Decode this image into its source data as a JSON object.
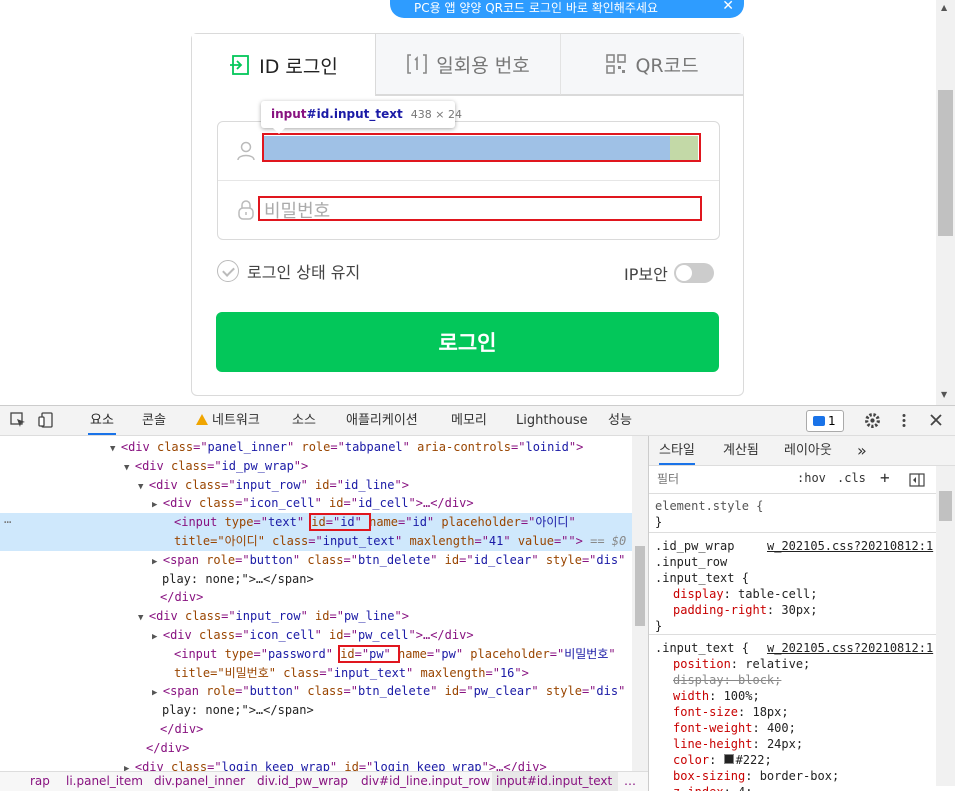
{
  "banner": {
    "text": "PC용 앱 양양 QR코드 로그인 바로 확인해주세요",
    "close": "✕"
  },
  "tabs": [
    {
      "label": "ID 로그인",
      "icon": "login-arrow-icon"
    },
    {
      "label": "일회용 번호",
      "icon": "number-one-icon"
    },
    {
      "label": "QR코드",
      "icon": "qr-code-icon"
    }
  ],
  "form": {
    "id_placeholder": "아이디",
    "pw_placeholder": "비밀번호",
    "keep_login": "로그인 상태 유지",
    "ip_security": "IP보안",
    "login_button": "로그인"
  },
  "tooltip": {
    "tag": "input",
    "selector": "#id.input_text",
    "size": "438 × 24"
  },
  "devtools": {
    "tabs": [
      "요소",
      "콘솔",
      "네트워크",
      "소스",
      "애플리케이션",
      "메모리",
      "Lighthouse",
      "성능"
    ],
    "badge_count": "1",
    "style_tabs": [
      "스타일",
      "계산됨",
      "레이아웃",
      "»"
    ],
    "filter_placeholder": "필터",
    "filter_hov": ":hov",
    "filter_cls": ".cls",
    "filter_plus": "+",
    "dom_lines": [
      {
        "pre": "<div ",
        "attrs": [
          [
            "class",
            "panel_inner"
          ],
          [
            "role",
            "tabpanel"
          ],
          [
            "aria-controls",
            "loinid"
          ]
        ],
        "post": ">"
      },
      {
        "pre": "<div ",
        "attrs": [
          [
            "class",
            "id_pw_wrap"
          ]
        ],
        "post": ">"
      },
      {
        "pre": "<div ",
        "attrs": [
          [
            "class",
            "input_row"
          ],
          [
            "id",
            "id_line"
          ]
        ],
        "post": ">"
      },
      {
        "pre": "<div ",
        "attrs": [
          [
            "class",
            "icon_cell"
          ],
          [
            "id",
            "id_cell"
          ]
        ],
        "post": ">…</div>"
      },
      {
        "pre": "<input ",
        "attrs": [
          [
            "type",
            "text"
          ],
          [
            "id",
            "id"
          ],
          [
            "name",
            "id"
          ],
          [
            "placeholder",
            "아이디"
          ]
        ],
        "post": ""
      },
      {
        "pre": "title=\"아이디\" ",
        "attrs": [
          [
            "class",
            "input_text"
          ],
          [
            "maxlength",
            "41"
          ],
          [
            "value",
            ""
          ]
        ],
        "post": "> == $0"
      },
      {
        "pre": "<span ",
        "attrs": [
          [
            "role",
            "button"
          ],
          [
            "class",
            "btn_delete"
          ],
          [
            "id",
            "id_clear"
          ],
          [
            "style",
            "dis"
          ]
        ],
        "post": ""
      },
      {
        "pre": "play: none;\">…</span>",
        "attrs": [],
        "post": ""
      },
      {
        "pre": "</div>",
        "attrs": [],
        "post": ""
      },
      {
        "pre": "<div ",
        "attrs": [
          [
            "class",
            "input_row"
          ],
          [
            "id",
            "pw_line"
          ]
        ],
        "post": ">"
      },
      {
        "pre": "<div ",
        "attrs": [
          [
            "class",
            "icon_cell"
          ],
          [
            "id",
            "pw_cell"
          ]
        ],
        "post": ">…</div>"
      },
      {
        "pre": "<input ",
        "attrs": [
          [
            "type",
            "password"
          ],
          [
            "id",
            "pw"
          ],
          [
            "name",
            "pw"
          ],
          [
            "placeholder",
            "비밀번호"
          ]
        ],
        "post": ""
      },
      {
        "pre": "title=\"비밀번호\" ",
        "attrs": [
          [
            "class",
            "input_text"
          ],
          [
            "maxlength",
            "16"
          ]
        ],
        "post": ">"
      },
      {
        "pre": "<span ",
        "attrs": [
          [
            "role",
            "button"
          ],
          [
            "class",
            "btn_delete"
          ],
          [
            "id",
            "pw_clear"
          ],
          [
            "style",
            "dis"
          ]
        ],
        "post": ""
      },
      {
        "pre": "play: none;\">…</span>",
        "attrs": [],
        "post": ""
      },
      {
        "pre": "</div>",
        "attrs": [],
        "post": ""
      },
      {
        "pre": "</div>",
        "attrs": [],
        "post": ""
      },
      {
        "pre": "<div ",
        "attrs": [
          [
            "class",
            "login_keep_wrap"
          ],
          [
            "id",
            "login_keep_wrap"
          ]
        ],
        "post": ">…</div>"
      }
    ],
    "rules": [
      {
        "t": "sel",
        "text": "element.style {"
      },
      {
        "t": "plain",
        "text": "}"
      },
      {
        "t": "selsrc",
        "text": ".id_pw_wrap",
        "src": "w_202105.css?20210812:1"
      },
      {
        "t": "sel",
        "text": ".input_row"
      },
      {
        "t": "sel",
        "text": ".input_text {"
      },
      {
        "t": "prop",
        "name": "display",
        "value": "table-cell;"
      },
      {
        "t": "prop",
        "name": "padding-right",
        "value": "30px;"
      },
      {
        "t": "plain",
        "text": "}"
      },
      {
        "t": "selsrc",
        "text": ".input_text {",
        "src": "w_202105.css?20210812:1"
      },
      {
        "t": "prop",
        "name": "position",
        "value": "relative;"
      },
      {
        "t": "strike",
        "name": "display",
        "value": "block;"
      },
      {
        "t": "prop",
        "name": "width",
        "value": "100%;"
      },
      {
        "t": "prop",
        "name": "font-size",
        "value": "18px;"
      },
      {
        "t": "prop",
        "name": "font-weight",
        "value": "400;"
      },
      {
        "t": "prop",
        "name": "line-height",
        "value": "24px;"
      },
      {
        "t": "color",
        "name": "color",
        "value": "#222;"
      },
      {
        "t": "prop",
        "name": "box-sizing",
        "value": "border-box;"
      },
      {
        "t": "prop",
        "name": "z-index",
        "value": "4;"
      }
    ],
    "breadcrumbs": [
      "rap",
      "li.panel_item",
      "div.panel_inner",
      "div.id_pw_wrap",
      "div#id_line.input_row",
      "input#id.input_text",
      "…"
    ]
  },
  "colors": {
    "login_green": "#03c75a",
    "highlight_blue": "#9fc1e6",
    "red_box": "#e0161e",
    "devtools_accent": "#1a73e8"
  }
}
